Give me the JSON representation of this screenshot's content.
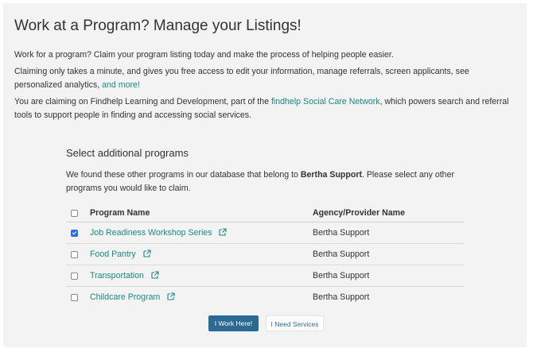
{
  "page": {
    "title": "Work at a Program? Manage your Listings!",
    "intro": "Work for a program? Claim your program listing today and make the process of helping people easier.",
    "claiming_text": "Claiming only takes a minute, and gives you free access to edit your information, manage referrals, screen applicants, see personalized analytics,",
    "and_more_link": "and more!",
    "network_prefix": "You are claiming on Findhelp Learning and Development, part of the",
    "network_link": "findhelp Social Care Network",
    "network_suffix": ", which powers search and referral tools to support people in finding and accessing social services."
  },
  "programs": {
    "section_title": "Select additional programs",
    "desc_prefix": "We found these other programs in our database that belong to",
    "agency_bold": "Bertha Support",
    "desc_suffix": ". Please select any other programs you would like to claim.",
    "col_program": "Program Name",
    "col_agency": "Agency/Provider Name",
    "rows": [
      {
        "name": "Job Readiness Workshop Series",
        "agency": "Bertha Support",
        "checked": true
      },
      {
        "name": "Food Pantry",
        "agency": "Bertha Support",
        "checked": false
      },
      {
        "name": "Transportation",
        "agency": "Bertha Support",
        "checked": false
      },
      {
        "name": "Childcare Program",
        "agency": "Bertha Support",
        "checked": false
      }
    ]
  },
  "actions": {
    "work_here": "I Work Here!",
    "need_services": "I Need Services"
  },
  "colors": {
    "link": "#1a8a83",
    "primary_button": "#2c6a96",
    "checkbox_checked": "#2b6fe0",
    "card_background": "#f3f3f3"
  },
  "icons": [
    "external-link-icon",
    "checkbox-icon"
  ]
}
